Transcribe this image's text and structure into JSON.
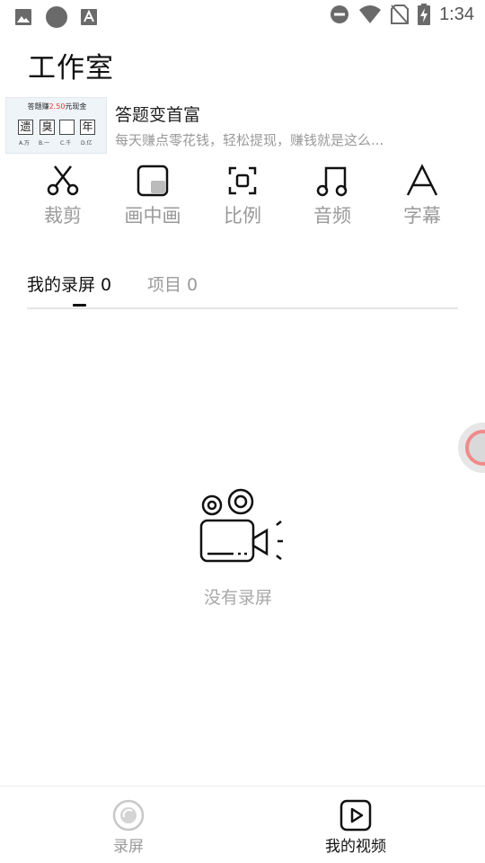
{
  "status_bar": {
    "time": "1:34",
    "left_icons": [
      "image-icon",
      "circle-icon",
      "font-icon"
    ],
    "right_icons": [
      "do-not-disturb-icon",
      "wifi-icon",
      "no-sim-icon",
      "battery-charging-icon"
    ]
  },
  "page": {
    "title": "工作室"
  },
  "ad": {
    "title": "答题变首富",
    "description": "每天赚点零花钱，轻松提现，赚钱就是这么...",
    "thumb": {
      "title_prefix": "答题赚",
      "title_highlight": "2.50",
      "title_suffix": "元现金",
      "chars": [
        "遗",
        "臭",
        "",
        "年"
      ],
      "options": [
        "A.万",
        "B.一",
        "C.千",
        "D.亿"
      ]
    }
  },
  "tools": [
    {
      "label": "裁剪",
      "icon": "scissors-icon"
    },
    {
      "label": "画中画",
      "icon": "picture-in-picture-icon"
    },
    {
      "label": "比例",
      "icon": "aspect-ratio-icon"
    },
    {
      "label": "音频",
      "icon": "music-note-icon"
    },
    {
      "label": "字幕",
      "icon": "subtitle-icon"
    }
  ],
  "tabs": {
    "active": "我的录屏 0",
    "inactive": "项目 0"
  },
  "empty": {
    "icon": "video-camera-icon",
    "text": "没有录屏"
  },
  "bottom_nav": {
    "items": [
      {
        "label": "录屏",
        "icon": "record-icon",
        "active": false
      },
      {
        "label": "我的视频",
        "icon": "play-square-icon",
        "active": true
      }
    ]
  },
  "colors": {
    "text_primary": "#111111",
    "text_secondary": "#9a9a9a",
    "accent_red": "#e23a2f",
    "divider": "#e6e6e6"
  }
}
